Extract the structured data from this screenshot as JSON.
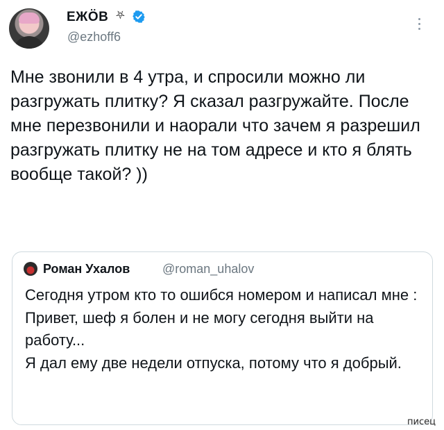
{
  "author": {
    "name": "ЕЖӦВ",
    "symbol": "⛧",
    "handle": "@ezhoff6"
  },
  "tweet": {
    "text": "Мне звонили в 4 утра, и спросили можно ли разгружать плитку? Я сказал разгружайте. После мне перезвонили и наорали что зачем я разрешил разгружать плитку не на том адресе и кто я блять вообще такой? ))"
  },
  "quote": {
    "name": "Роман Ухалов",
    "handle": "@roman_uhalov",
    "text": "Сегодня утром кто то ошибся номером и написал мне : Привет, шеф я болен и не могу сегодня выйти на работу...\nЯ дал ему две недели отпуска, потому что я добрый."
  },
  "watermark": "писец",
  "colors": {
    "verified": "#1d9bf0",
    "text": "#0f1419",
    "secondary": "#6b7780",
    "border": "#cfd9de"
  }
}
